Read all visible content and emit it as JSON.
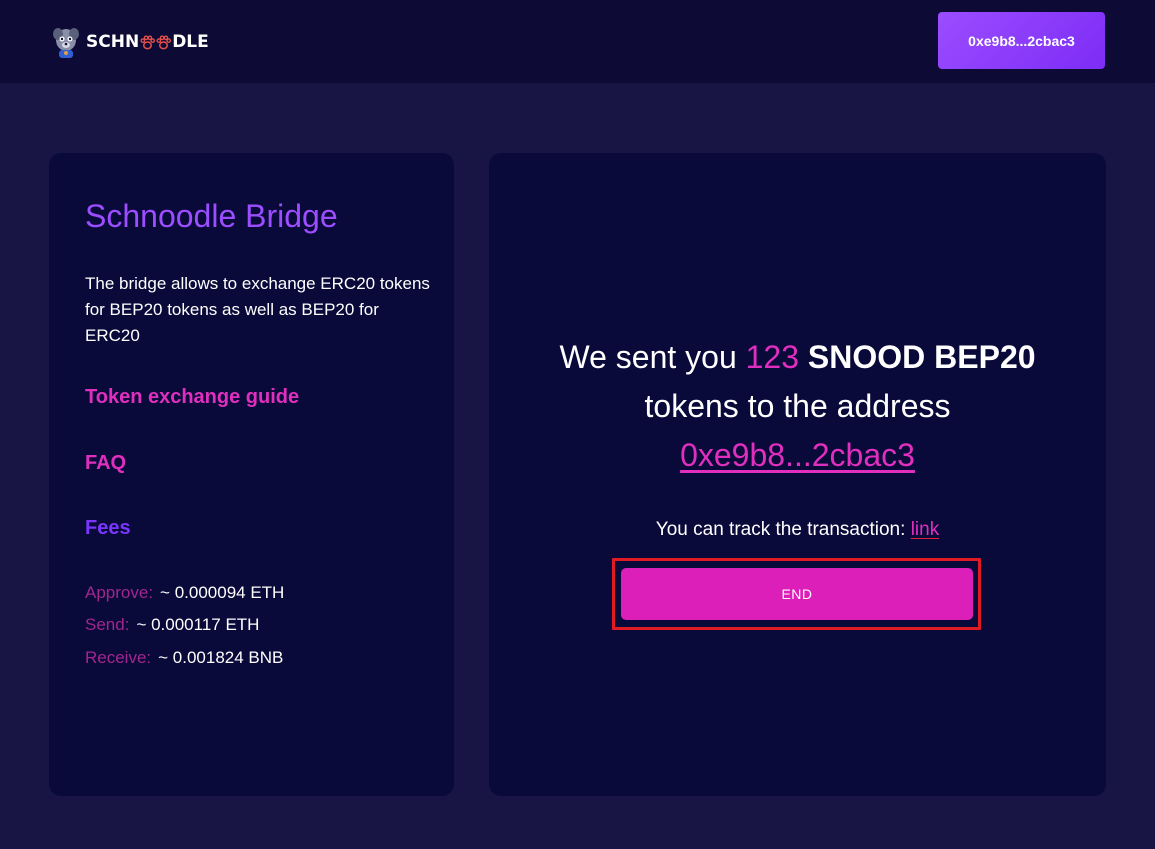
{
  "header": {
    "logo_text_left": "SCHN",
    "logo_text_right": "DLE",
    "logo_icons": [
      "mascot-icon",
      "paw-icon",
      "paw-icon"
    ],
    "wallet_address": "0xe9b8...2cbac3"
  },
  "sidebar": {
    "title": "Schnoodle Bridge",
    "description": "The bridge allows to exchange ERC20 tokens for BEP20 tokens as well as BEP20 for ERC20",
    "links": {
      "guide": "Token exchange guide",
      "faq": "FAQ",
      "fees": "Fees"
    },
    "fees": [
      {
        "label": "Approve:",
        "value": "~ 0.000094 ETH"
      },
      {
        "label": "Send:",
        "value": "~ 0.000117 ETH"
      },
      {
        "label": "Receive:",
        "value": "~ 0.001824 BNB"
      }
    ]
  },
  "main": {
    "prefix": "We sent you ",
    "amount": "123",
    "token": "SNOOD BEP20",
    "middle": "tokens to the address",
    "address": "0xe9b8...2cbac3",
    "track_text": "You can track the transaction: ",
    "track_link": "link",
    "end_button": "END"
  },
  "colors": {
    "background": "#181545",
    "panel": "#09093a",
    "accent_pink": "#e02fbf",
    "accent_purple": "#9b4dff",
    "highlight_frame": "#e01b24"
  }
}
